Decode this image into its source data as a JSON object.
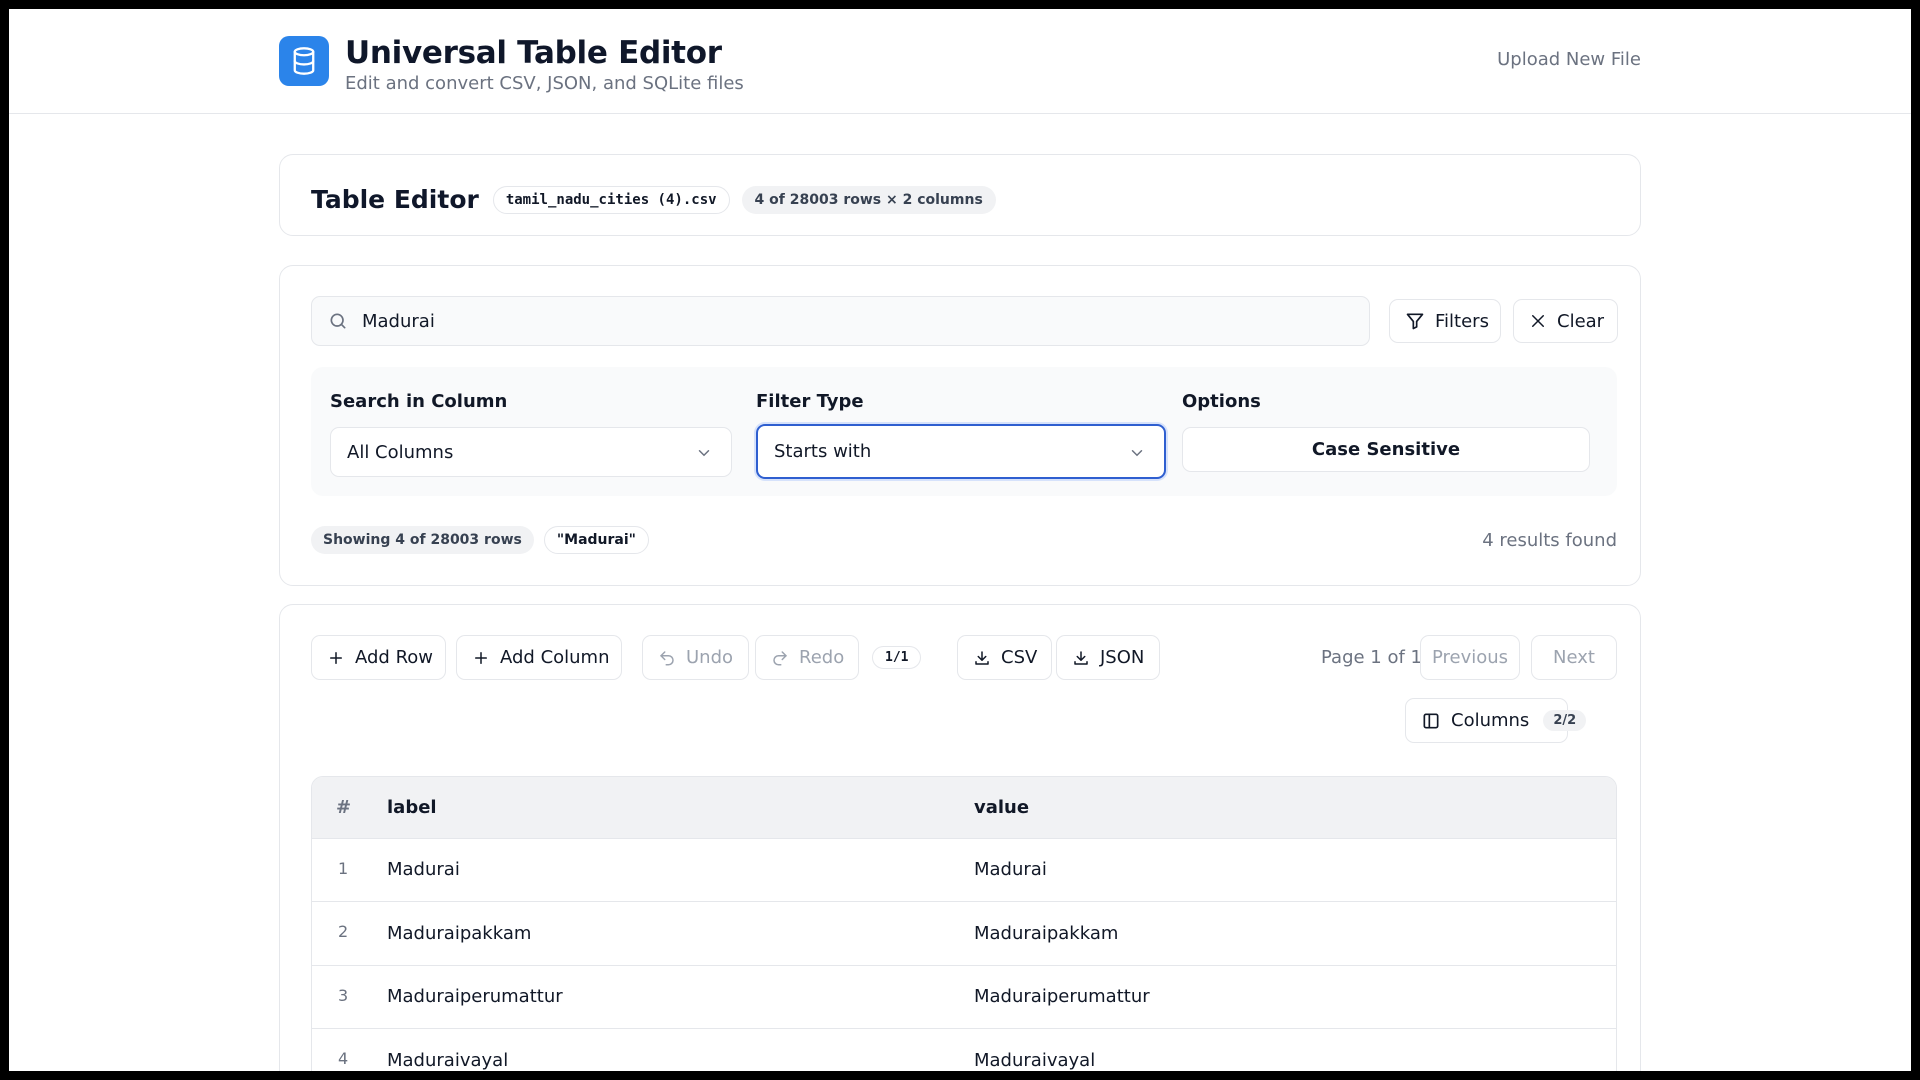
{
  "app": {
    "title": "Universal Table Editor",
    "subtitle": "Edit and convert CSV, JSON, and SQLite files",
    "upload_label": "Upload New File"
  },
  "editor": {
    "title": "Table Editor",
    "filename": "tamil_nadu_cities (4).csv",
    "rows_info": "4 of 28003 rows × 2 columns"
  },
  "search": {
    "value": "Madurai",
    "filters_label": "Filters",
    "clear_label": "Clear"
  },
  "filter_panel": {
    "column_label": "Search in Column",
    "column_value": "All Columns",
    "type_label": "Filter Type",
    "type_value": "Starts with",
    "options_label": "Options",
    "case_label": "Case Sensitive"
  },
  "results": {
    "showing": "Showing 4 of 28003 rows",
    "query_chip": "\"Madurai\"",
    "count": "4 results found"
  },
  "toolbar": {
    "add_row": "Add Row",
    "add_column": "Add Column",
    "undo": "Undo",
    "redo": "Redo",
    "history": "1/1",
    "csv": "CSV",
    "json": "JSON",
    "page_info": "Page 1 of 1",
    "previous": "Previous",
    "next": "Next",
    "columns_label": "Columns",
    "columns_count": "2/2"
  },
  "table": {
    "headers": [
      "#",
      "label",
      "value"
    ],
    "rows": [
      [
        "1",
        "Madurai",
        "Madurai"
      ],
      [
        "2",
        "Maduraipakkam",
        "Maduraipakkam"
      ],
      [
        "3",
        "Maduraiperumattur",
        "Maduraiperumattur"
      ],
      [
        "4",
        "Maduraivayal",
        "Maduraivayal"
      ]
    ]
  },
  "colors": {
    "accent": "#2b84ea",
    "focus_ring": "#2f5fd0"
  },
  "icons": [
    "database-icon",
    "search-icon",
    "filter-icon",
    "close-icon",
    "chevron-down-icon",
    "plus-icon",
    "undo-icon",
    "redo-icon",
    "download-icon",
    "columns-icon"
  ]
}
